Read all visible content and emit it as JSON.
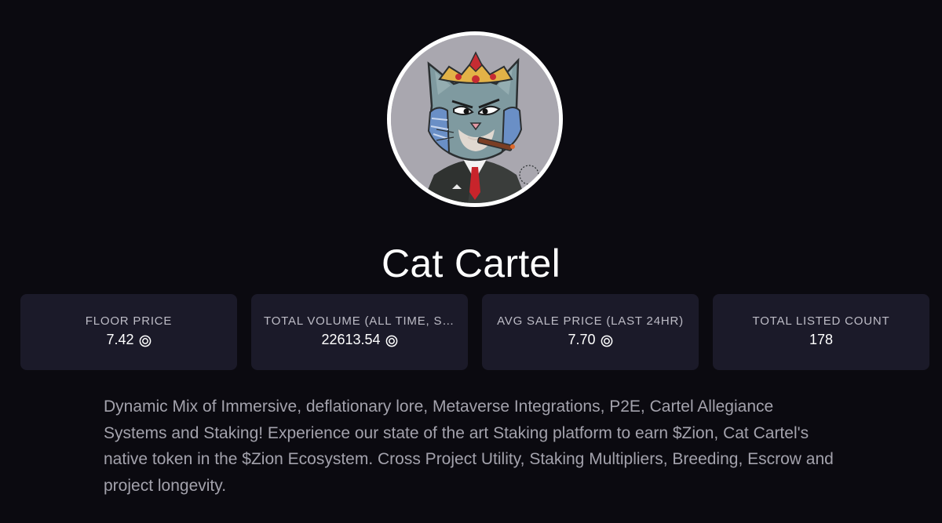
{
  "collection": {
    "name": "Cat Cartel",
    "avatar_icon": "cat-king-avatar-icon",
    "description": "Dynamic Mix of Immersive, deflationary lore, Metaverse Integrations, P2E, Cartel Allegiance Systems and Staking! Experience our state of the art Staking platform to earn $Zion, Cat Cartel's native token in the $Zion Ecosystem. Cross Project Utility, Staking Multipliers, Breeding, Escrow and project longevity."
  },
  "stats": [
    {
      "label": "FLOOR PRICE",
      "value": "7.42",
      "currency_icon": "sol-coin-icon"
    },
    {
      "label": "TOTAL VOLUME (ALL TIME, SOL)",
      "value": "22613.54",
      "currency_icon": "sol-coin-icon"
    },
    {
      "label": "AVG SALE PRICE (LAST 24HR)",
      "value": "7.70",
      "currency_icon": "sol-coin-icon"
    },
    {
      "label": "TOTAL LISTED COUNT",
      "value": "178"
    }
  ],
  "colors": {
    "background": "#0b0a10",
    "card": "#1b1a29",
    "label": "#bdbcc6",
    "description": "#a3a2ac"
  }
}
